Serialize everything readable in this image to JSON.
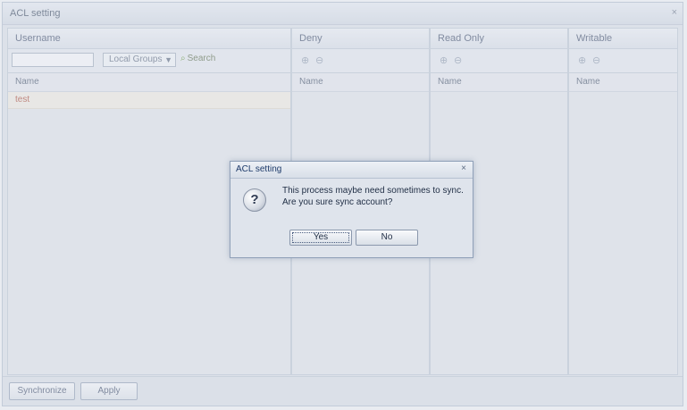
{
  "window": {
    "title": "ACL setting",
    "close_glyph": "×"
  },
  "left_panel": {
    "header": "Username",
    "search": {
      "value": "",
      "placeholder": ""
    },
    "filter_select": {
      "value": "Local Groups"
    },
    "search_button": "Search",
    "column_header": "Name",
    "rows": [
      {
        "name": "test"
      }
    ]
  },
  "permission_panels": [
    {
      "title": "Deny",
      "column_header": "Name"
    },
    {
      "title": "Read Only",
      "column_header": "Name"
    },
    {
      "title": "Writable",
      "column_header": "Name"
    }
  ],
  "footer": {
    "sync_button": "Synchronize",
    "apply_button": "Apply"
  },
  "dialog": {
    "title": "ACL setting",
    "close_glyph": "×",
    "message_line1": "This process maybe need sometimes to sync.",
    "message_line2": "Are you sure sync account?",
    "yes_button": "Yes",
    "no_button": "No",
    "icon": "question-icon"
  }
}
